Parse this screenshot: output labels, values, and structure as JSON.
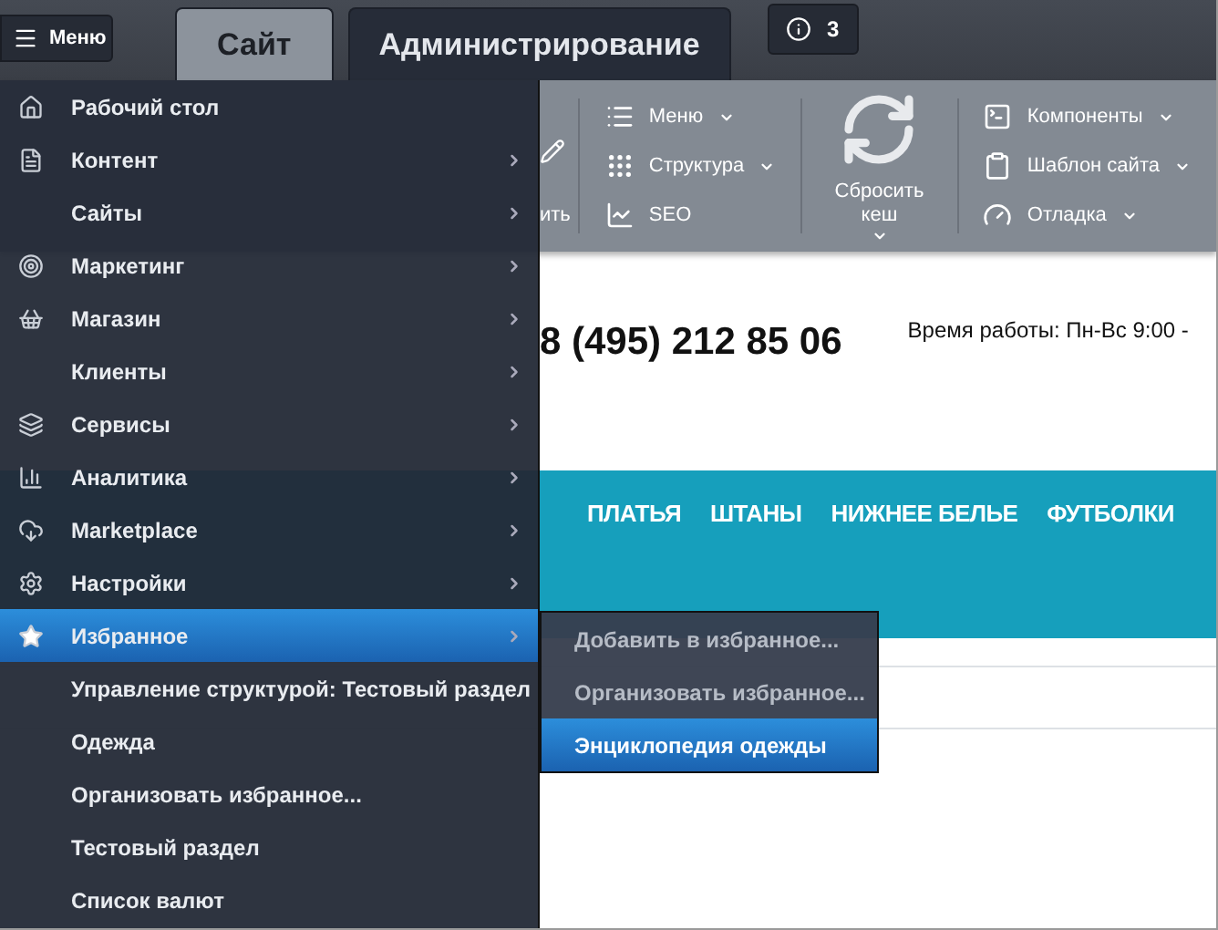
{
  "top_bar": {
    "menu_button": {
      "label": "Меню"
    },
    "tabs": [
      {
        "label": "Сайт",
        "selected": true
      },
      {
        "label": "Администрирование",
        "selected": false
      }
    ],
    "notifications": {
      "count": "3"
    }
  },
  "toolbar": {
    "cut_button": {
      "label": "ить"
    },
    "column_1": [
      {
        "label": "Меню",
        "dropdown": true
      },
      {
        "label": "Структура",
        "dropdown": true
      },
      {
        "label": "SEO",
        "dropdown": false
      }
    ],
    "reset_cache": {
      "label_lines": [
        "Сбросить",
        "кеш"
      ],
      "dropdown": true
    },
    "column_2": [
      {
        "label": "Компоненты",
        "dropdown": true
      },
      {
        "label": "Шаблон сайта",
        "dropdown": true
      },
      {
        "label": "Отладка",
        "dropdown": true
      }
    ]
  },
  "site_header": {
    "phone": "8 (495) 212 85 06",
    "hours": "Время работы: Пн-Вс 9:00 -"
  },
  "site_nav": {
    "items": [
      "ПЛАТЬЯ",
      "ШТАНЫ",
      "НИЖНЕЕ БЕЛЬЕ",
      "ФУТБОЛКИ"
    ]
  },
  "main_menu": {
    "items": [
      {
        "label": "Рабочий стол",
        "has_submenu": false,
        "selected": false
      },
      {
        "label": "Контент",
        "has_submenu": true,
        "selected": false
      },
      {
        "label": "Сайты",
        "has_submenu": true,
        "selected": false
      },
      {
        "label": "Маркетинг",
        "has_submenu": true,
        "selected": false
      },
      {
        "label": "Магазин",
        "has_submenu": true,
        "selected": false
      },
      {
        "label": "Клиенты",
        "has_submenu": true,
        "selected": false
      },
      {
        "label": "Сервисы",
        "has_submenu": true,
        "selected": false
      },
      {
        "label": "Аналитика",
        "has_submenu": true,
        "selected": false
      },
      {
        "label": "Marketplace",
        "has_submenu": true,
        "selected": false
      },
      {
        "label": "Настройки",
        "has_submenu": true,
        "selected": false
      },
      {
        "label": "Избранное",
        "has_submenu": true,
        "selected": true
      },
      {
        "label": "Управление структурой: Тестовый раздел",
        "has_submenu": false,
        "selected": false
      },
      {
        "label": "Одежда",
        "has_submenu": false,
        "selected": false
      },
      {
        "label": "Организовать избранное...",
        "has_submenu": false,
        "selected": false
      },
      {
        "label": "Тестовый раздел",
        "has_submenu": false,
        "selected": false
      },
      {
        "label": "Список валют",
        "has_submenu": false,
        "selected": false
      }
    ],
    "submenu": [
      {
        "label": "Добавить в избранное...",
        "selected": false
      },
      {
        "label": "Организовать избранное...",
        "selected": false
      },
      {
        "label": "Энциклопедия одежды",
        "selected": true
      }
    ]
  }
}
